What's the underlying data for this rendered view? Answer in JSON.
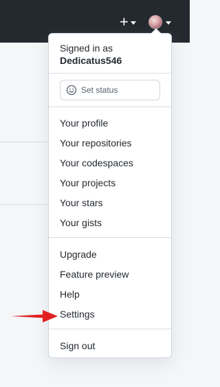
{
  "header": {
    "plus_icon": "plus-icon",
    "plus_symbol": "+",
    "avatar_alt": "avatar"
  },
  "menu": {
    "signed_in_label": "Signed in as",
    "username": "Dedicatus546",
    "set_status_label": "Set status",
    "section1": [
      "Your profile",
      "Your repositories",
      "Your codespaces",
      "Your projects",
      "Your stars",
      "Your gists"
    ],
    "section2": [
      "Upgrade",
      "Feature preview",
      "Help",
      "Settings"
    ],
    "sign_out": "Sign out"
  },
  "colors": {
    "header_bg": "#24292f",
    "annotation_arrow": "#e02020"
  }
}
